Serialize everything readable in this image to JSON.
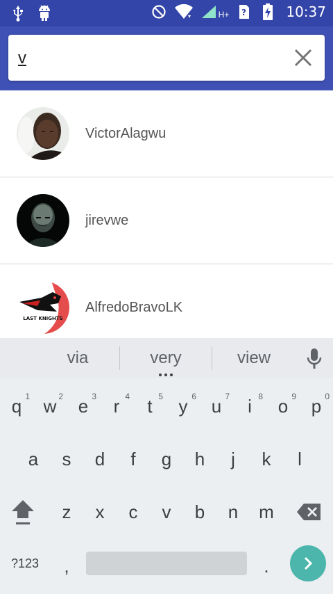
{
  "status_bar": {
    "time": "10:37",
    "network_label": "H+",
    "icons": [
      "usb-icon",
      "android-icon",
      "do-not-disturb-icon",
      "wifi-icon",
      "cellular-signal-icon",
      "sim-unknown-icon",
      "battery-charging-icon"
    ]
  },
  "search": {
    "value": "v",
    "clear_icon": "close-icon"
  },
  "results": [
    {
      "name": "VictorAlagwu",
      "avatar": "photo"
    },
    {
      "name": "jirevwe",
      "avatar": "photo"
    },
    {
      "name": "AlfredoBravoLK",
      "avatar": "logo",
      "avatar_text": "LAST KNIGHTS"
    }
  ],
  "suggestions": [
    "via",
    "very",
    "view"
  ],
  "keyboard": {
    "row1": [
      {
        "label": "q",
        "hint": "1"
      },
      {
        "label": "w",
        "hint": "2"
      },
      {
        "label": "e",
        "hint": "3"
      },
      {
        "label": "r",
        "hint": "4"
      },
      {
        "label": "t",
        "hint": "5"
      },
      {
        "label": "y",
        "hint": "6"
      },
      {
        "label": "u",
        "hint": "7"
      },
      {
        "label": "i",
        "hint": "8"
      },
      {
        "label": "o",
        "hint": "9"
      },
      {
        "label": "p",
        "hint": "0"
      }
    ],
    "row2": [
      "a",
      "s",
      "d",
      "f",
      "g",
      "h",
      "j",
      "k",
      "l"
    ],
    "row3": [
      "z",
      "x",
      "c",
      "v",
      "b",
      "n",
      "m"
    ],
    "symbols_label": "?123",
    "comma_label": ",",
    "period_label": ".",
    "accent_color": "#4db6ac"
  },
  "colors": {
    "status_bar": "#3345a8",
    "toolbar": "#3f51b5"
  }
}
